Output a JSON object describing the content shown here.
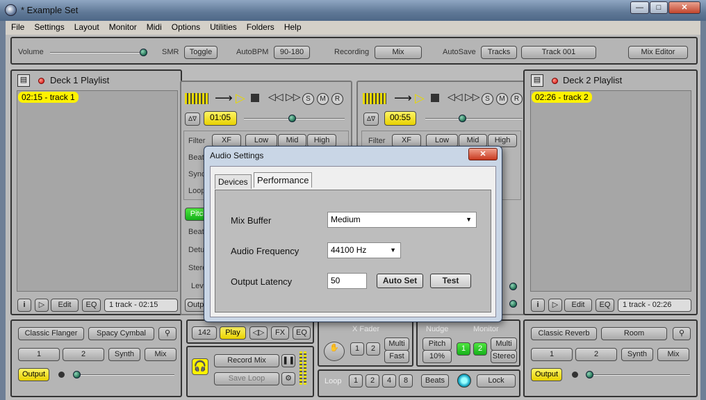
{
  "window": {
    "title": "* Example Set",
    "min": "0",
    "max": "1",
    "close": "r"
  },
  "menu": [
    "File",
    "Settings",
    "Layout",
    "Monitor",
    "Midi",
    "Options",
    "Utilities",
    "Folders",
    "Help"
  ],
  "topbar": {
    "volume": "Volume",
    "smr": "SMR",
    "toggle": "Toggle",
    "autobpm": "AutoBPM",
    "bpm_range": "90-180",
    "recording": "Recording",
    "mix": "Mix",
    "autosave": "AutoSave",
    "tracks": "Tracks",
    "track001": "Track 001",
    "mix_editor": "Mix Editor"
  },
  "deck1": {
    "title": "Deck 1 Playlist",
    "item": "02:15 - track 1",
    "info": "1 track - 02:15",
    "edit": "Edit",
    "eq": "EQ",
    "time": "01:05",
    "filter": "Filter",
    "xf": "XF",
    "low": "Low",
    "mid": "Mid",
    "high": "High",
    "beat": "Beat",
    "sync": "Sync",
    "loop": "Loop",
    "pitch": "Pitch",
    "beat2": "Beat",
    "detune": "Detune",
    "stereo": "Stereo",
    "level": "Level",
    "output": "Output"
  },
  "deck2": {
    "title": "Deck 2 Playlist",
    "item": "02:26 - track 2",
    "info": "1 track - 02:26",
    "edit": "Edit",
    "eq": "EQ",
    "time": "00:55",
    "filter": "Filter",
    "xf": "XF",
    "low": "Low",
    "mid": "Mid",
    "high": "High"
  },
  "transport": {
    "s": "S",
    "m": "M",
    "r": "R"
  },
  "fx1": {
    "flanger": "Classic Flanger",
    "cymbal": "Spacy Cymbal",
    "b1": "1",
    "b2": "2",
    "synth": "Synth",
    "mix": "Mix",
    "output": "Output"
  },
  "fx2": {
    "reverb": "Classic Reverb",
    "room": "Room",
    "b1": "1",
    "b2": "2",
    "synth": "Synth",
    "mix": "Mix",
    "output": "Output"
  },
  "center": {
    "bpm": "142",
    "play": "Play",
    "fx": "FX",
    "eq": "EQ",
    "record_mix": "Record Mix",
    "save_loop": "Save Loop",
    "xfader": "X Fader",
    "b1": "1",
    "b2": "2",
    "multi": "Multi",
    "fast": "Fast",
    "nudge": "Nudge",
    "pitch": "Pitch",
    "pct": "10%",
    "monitor": "Monitor",
    "m1": "1",
    "m2": "2",
    "mmulti": "Multi",
    "stereo": "Stereo",
    "loop": "Loop",
    "l1": "1",
    "l2": "2",
    "l4": "4",
    "l8": "8",
    "beats": "Beats",
    "lock": "Lock"
  },
  "dialog": {
    "title": "Audio Settings",
    "close": "x",
    "tab_devices": "Devices",
    "tab_performance": "Performance",
    "mix_buffer_label": "Mix Buffer",
    "mix_buffer_value": "Medium",
    "freq_label": "Audio Frequency",
    "freq_value": "44100 Hz",
    "latency_label": "Output Latency",
    "latency_value": "50",
    "auto_set": "Auto Set",
    "test": "Test"
  },
  "colors": {
    "accent_yellow": "#fff200",
    "green": "#22c21f",
    "panel": "#b5b5b5"
  },
  "levels": {
    "volume": 1.0,
    "deck1_pos": 0.55,
    "deck2_pos": 0.45,
    "fx_out": 0.0
  }
}
